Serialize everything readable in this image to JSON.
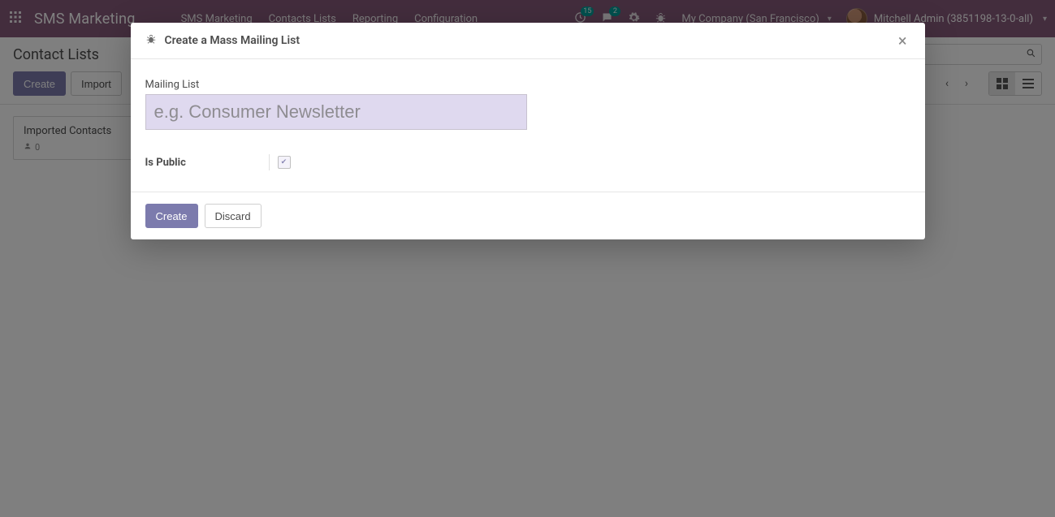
{
  "navbar": {
    "brand": "SMS Marketing",
    "menu": [
      "SMS Marketing",
      "Contacts Lists",
      "Reporting",
      "Configuration"
    ],
    "clock_badge": "15",
    "chat_badge": "2",
    "company": "My Company (San Francisco)",
    "user": "Mitchell Admin (3851198-13-0-all)"
  },
  "control_panel": {
    "breadcrumb": "Contact Lists",
    "create": "Create",
    "import": "Import"
  },
  "kanban": {
    "card_title": "Imported Contacts",
    "card_count": "0"
  },
  "modal": {
    "title": "Create a Mass Mailing List",
    "field_label": "Mailing List",
    "placeholder": "e.g. Consumer Newsletter",
    "value": "",
    "is_public_label": "Is Public",
    "is_public_checked": true,
    "create": "Create",
    "discard": "Discard"
  }
}
